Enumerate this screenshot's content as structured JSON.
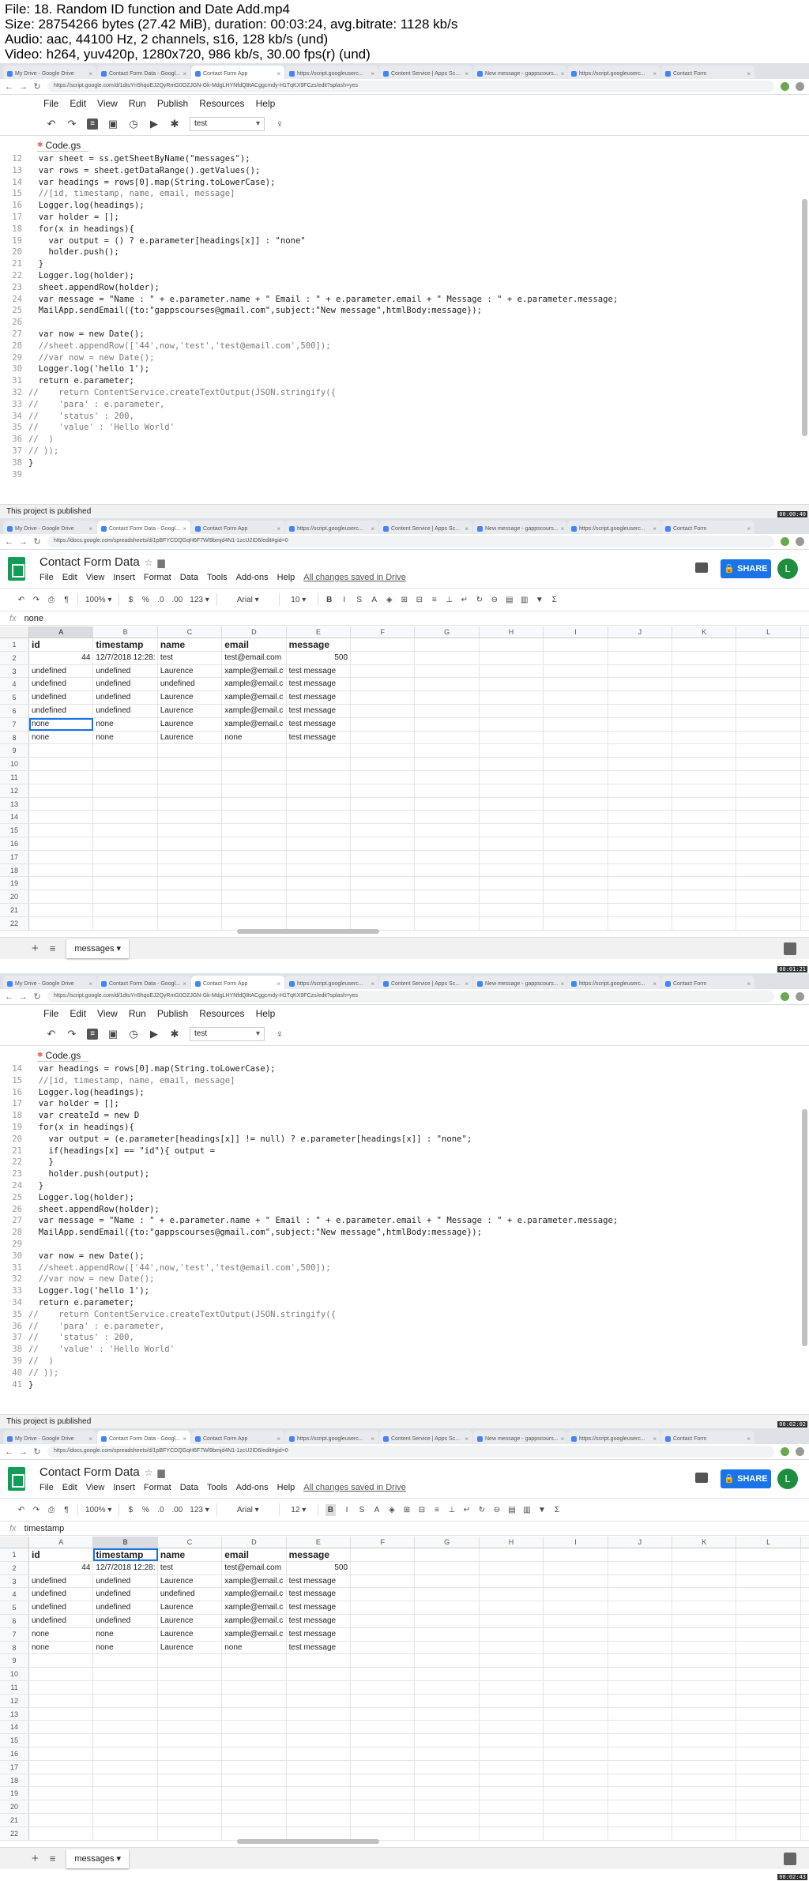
{
  "media_info": [
    "File: 18. Random ID function and Date Add.mp4",
    "Size: 28754266 bytes (27.42 MiB), duration: 00:03:24, avg.bitrate: 1128 kb/s",
    "Audio: aac, 44100 Hz, 2 channels, s16, 128 kb/s (und)",
    "Video: h264, yuv420p, 1280x720, 986 kb/s, 30.00 fps(r) (und)"
  ],
  "browser": {
    "tabs": [
      "My Drive - Google Drive",
      "Contact Form Data - Googl...",
      "Contact Form App",
      "https://script.googleuserc...",
      "Content Service | Apps Sc...",
      "New message - gappscours...",
      "https://script.googleuserc...",
      "Contact Form"
    ],
    "url_script": "https://script.google.com/d/1dtuYn5hqoEJ2QyRmG0OZJGN-Gk-MdgLHYNfdQ8tACggcmdy-H1TqKX9FCzs/edit?splash=yes",
    "url_sheet": "https://docs.google.com/spreadsheets/d/1pBFYCDQGqH6F7Wl9bmjd4N1-1zcU2ID6/edit#gid=0"
  },
  "script_editor": {
    "menu": [
      "File",
      "Edit",
      "View",
      "Run",
      "Publish",
      "Resources",
      "Help"
    ],
    "function_select": "test",
    "file_tab": "Code.gs",
    "status": "This project is published",
    "code_a": [
      {
        "n": "12",
        "t": "  var sheet = ss.getSheetByName(\"messages\");"
      },
      {
        "n": "13",
        "t": "  var rows = sheet.getDataRange().getValues();"
      },
      {
        "n": "14",
        "t": "  var headings = rows[0].map(String.toLowerCase);"
      },
      {
        "n": "15",
        "t": "  //[id, timestamp, name, email, message]"
      },
      {
        "n": "16",
        "t": "  Logger.log(headings);"
      },
      {
        "n": "17",
        "t": "  var holder = [];"
      },
      {
        "n": "18",
        "t": "  for(x in headings){"
      },
      {
        "n": "19",
        "t": "    var output = () ? e.parameter[headings[x]] : \"none\""
      },
      {
        "n": "20",
        "t": "    holder.push();"
      },
      {
        "n": "21",
        "t": "  }"
      },
      {
        "n": "22",
        "t": "  Logger.log(holder);"
      },
      {
        "n": "23",
        "t": "  sheet.appendRow(holder);"
      },
      {
        "n": "24",
        "t": "  var message = \"Name : \" + e.parameter.name + \" Email : \" + e.parameter.email + \" Message : \" + e.parameter.message;"
      },
      {
        "n": "25",
        "t": "  MailApp.sendEmail({to:\"gappscourses@gmail.com\",subject:\"New message\",htmlBody:message});"
      },
      {
        "n": "26",
        "t": ""
      },
      {
        "n": "27",
        "t": "  var now = new Date();"
      },
      {
        "n": "28",
        "t": "  //sheet.appendRow(['44',now,'test','test@email.com',500]);"
      },
      {
        "n": "29",
        "t": "  //var now = new Date();"
      },
      {
        "n": "30",
        "t": "  Logger.log('hello 1');"
      },
      {
        "n": "31",
        "t": "  return e.parameter;"
      },
      {
        "n": "32",
        "t": "//    return ContentService.createTextOutput(JSON.stringify({"
      },
      {
        "n": "33",
        "t": "//    'para' : e.parameter,"
      },
      {
        "n": "34",
        "t": "//    'status' : 200,"
      },
      {
        "n": "35",
        "t": "//    'value' : 'Hello World'"
      },
      {
        "n": "36",
        "t": "//  )"
      },
      {
        "n": "37",
        "t": "// ));"
      },
      {
        "n": "38",
        "t": "}"
      },
      {
        "n": "39",
        "t": ""
      }
    ],
    "code_b": [
      {
        "n": "14",
        "t": "  var headings = rows[0].map(String.toLowerCase);"
      },
      {
        "n": "15",
        "t": "  //[id, timestamp, name, email, message]"
      },
      {
        "n": "16",
        "t": "  Logger.log(headings);"
      },
      {
        "n": "17",
        "t": "  var holder = [];"
      },
      {
        "n": "18",
        "t": "  var createId = new D"
      },
      {
        "n": "19",
        "t": "  for(x in headings){"
      },
      {
        "n": "20",
        "t": "    var output = (e.parameter[headings[x]] != null) ? e.parameter[headings[x]] : \"none\";"
      },
      {
        "n": "21",
        "t": "    if(headings[x] == \"id\"){ output ="
      },
      {
        "n": "22",
        "t": "    }"
      },
      {
        "n": "23",
        "t": "    holder.push(output);"
      },
      {
        "n": "24",
        "t": "  }"
      },
      {
        "n": "25",
        "t": "  Logger.log(holder);"
      },
      {
        "n": "26",
        "t": "  sheet.appendRow(holder);"
      },
      {
        "n": "27",
        "t": "  var message = \"Name : \" + e.parameter.name + \" Email : \" + e.parameter.email + \" Message : \" + e.parameter.message;"
      },
      {
        "n": "28",
        "t": "  MailApp.sendEmail({to:\"gappscourses@gmail.com\",subject:\"New message\",htmlBody:message});"
      },
      {
        "n": "29",
        "t": ""
      },
      {
        "n": "30",
        "t": "  var now = new Date();"
      },
      {
        "n": "31",
        "t": "  //sheet.appendRow(['44',now,'test','test@email.com',500]);"
      },
      {
        "n": "32",
        "t": "  //var now = new Date();"
      },
      {
        "n": "33",
        "t": "  Logger.log('hello 1');"
      },
      {
        "n": "34",
        "t": "  return e.parameter;"
      },
      {
        "n": "35",
        "t": "//    return ContentService.createTextOutput(JSON.stringify({"
      },
      {
        "n": "36",
        "t": "//    'para' : e.parameter,"
      },
      {
        "n": "37",
        "t": "//    'status' : 200,"
      },
      {
        "n": "38",
        "t": "//    'value' : 'Hello World'"
      },
      {
        "n": "39",
        "t": "//  )"
      },
      {
        "n": "40",
        "t": "// ));"
      },
      {
        "n": "41",
        "t": "}"
      }
    ]
  },
  "sheet": {
    "title": "Contact Form Data",
    "menu": [
      "File",
      "Edit",
      "View",
      "Insert",
      "Format",
      "Data",
      "Tools",
      "Add-ons",
      "Help"
    ],
    "saved": "All changes saved in Drive",
    "share": "SHARE",
    "avatar": "L",
    "toolbar": {
      "zoom": "100%",
      "currency": "$",
      "percent": "%",
      "dec1": ".0",
      "dec2": ".00",
      "fmt": "123",
      "font": "Arial",
      "size_a": "10",
      "size_b": "12"
    },
    "fx": "fx",
    "formula_a": "none",
    "formula_b": "timestamp",
    "columns": [
      "A",
      "B",
      "C",
      "D",
      "E",
      "F",
      "G",
      "H",
      "I",
      "J",
      "K",
      "L"
    ],
    "headers": [
      "id",
      "timestamp",
      "name",
      "email",
      "message"
    ],
    "rows": [
      [
        "44",
        "12/7/2018 12:28:",
        "test",
        "test@email.com",
        "500"
      ],
      [
        "undefined",
        "undefined",
        "Laurence",
        "xample@email.c",
        "test message"
      ],
      [
        "undefined",
        "undefined",
        "undefined",
        "xample@email.c",
        "test message"
      ],
      [
        "undefined",
        "undefined",
        "Laurence",
        "xample@email.c",
        "test message"
      ],
      [
        "undefined",
        "undefined",
        "Laurence",
        "xample@email.c",
        "test message"
      ],
      [
        "none",
        "none",
        "Laurence",
        "xample@email.c",
        "test message"
      ],
      [
        "none",
        "none",
        "Laurence",
        "none",
        "test message"
      ]
    ],
    "row_count": 22,
    "sheet_tab": "messages"
  },
  "timecodes": [
    "00:00:40",
    "00:01:21",
    "00:02:02",
    "00:02:43"
  ]
}
